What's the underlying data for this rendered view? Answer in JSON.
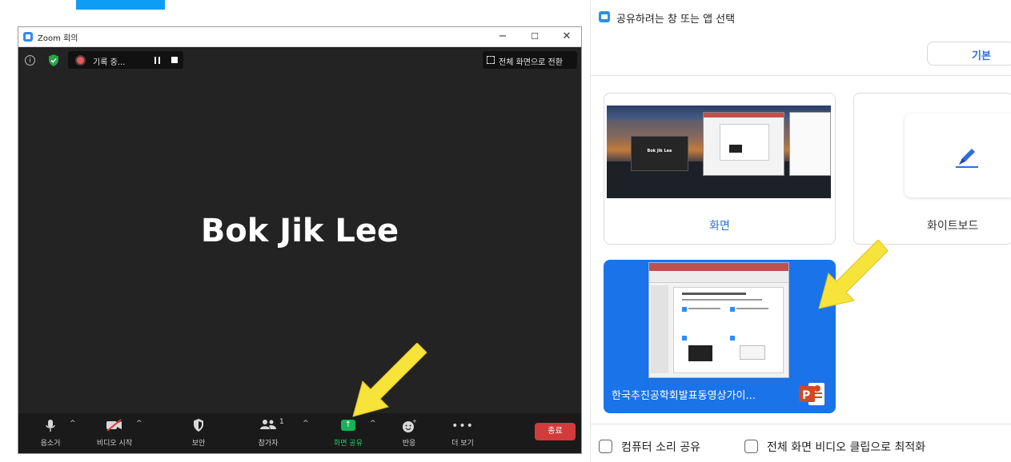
{
  "zoom": {
    "window_title": "Zoom 회의",
    "controls": {
      "minimize": "−",
      "maximize": "☐",
      "close": "✕"
    },
    "info_icon": "i",
    "recording_text": "기록 중...",
    "fullscreen_label": "전체 화면으로 전환",
    "participant_name": "Bok Jik Lee",
    "toolbar": {
      "mute_label": "음소거",
      "video_label": "비디오 시작",
      "security_label": "보안",
      "participants_label": "참가자",
      "participants_count": "1",
      "share_label": "화면 공유",
      "reactions_label": "반응",
      "more_label": "더 보기",
      "end_label": "종료",
      "caret": "^"
    }
  },
  "share_dialog": {
    "title": "공유하려는 창 또는 앱 선택",
    "tab_basic": "기본",
    "cards": {
      "screen_label": "화면",
      "whiteboard_label": "화이트보드",
      "ppt_label": "한국추진공학회발표동영상가이..."
    },
    "options": {
      "share_sound": "컴퓨터 소리 공유",
      "optimize_video": "전체 화면 비디오 클립으로 최적화"
    },
    "thumbnail_name": "Bok Jik Lee"
  },
  "colors": {
    "zoom_blue": "#2D8CFF",
    "selected_card": "#1a73e8",
    "share_green": "#17b359",
    "end_red": "#d23b3b",
    "arrow_yellow": "#F7E43A"
  }
}
